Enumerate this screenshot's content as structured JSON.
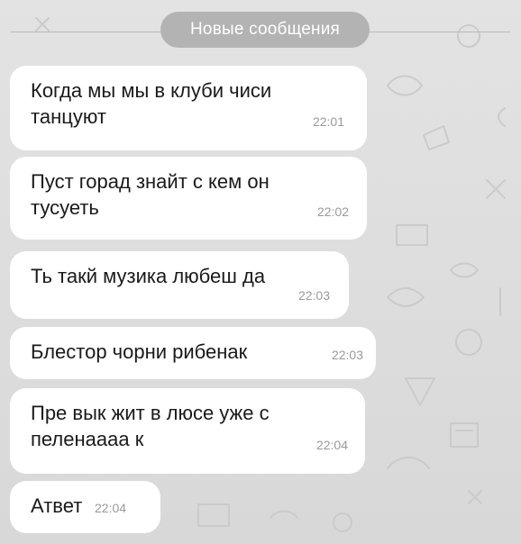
{
  "chat": {
    "new_messages_label": "Новые сообщения",
    "messages": [
      {
        "text": "Когда мы мы в клуби чиси\nтанцуют",
        "time": "22:01"
      },
      {
        "text": "Пуст горад знайт с кем он\nтусуеть",
        "time": "22:02"
      },
      {
        "text": "Ть такй музика любеш да",
        "time": "22:03"
      },
      {
        "text": "Блестор чорни рибенак",
        "time": "22:03"
      },
      {
        "text": "Пре вык жит в люсе уже с\nпеленаааа к",
        "time": "22:04"
      },
      {
        "text": "Атвет",
        "time": "22:04"
      }
    ]
  },
  "colors": {
    "background": "#dcdcdc",
    "bubble": "#ffffff",
    "badge": "#b3b3b3",
    "timestamp": "#9a9a9a"
  }
}
